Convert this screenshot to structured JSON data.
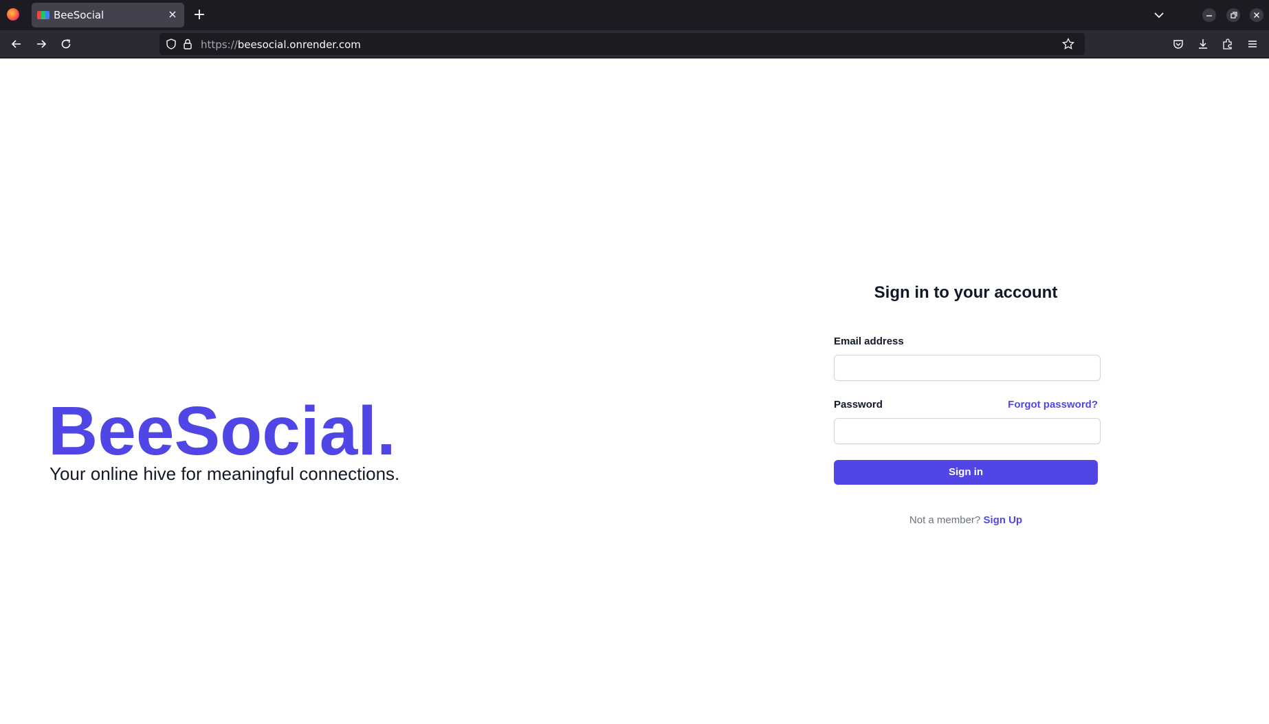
{
  "browser": {
    "tab_title": "BeeSocial",
    "tab_close": "×",
    "new_tab": "+",
    "url_protocol": "https://",
    "url_host": "beesocial.onrender.com"
  },
  "page": {
    "brand": "BeeSocial.",
    "tagline": "Your online hive for meaningful connections.",
    "signin_title": "Sign in to your account",
    "email_label": "Email address",
    "email_value": "",
    "password_label": "Password",
    "password_value": "",
    "forgot_link": "Forgot password?",
    "signin_button": "Sign in",
    "not_member_text": "Not a member?",
    "signup_link": "Sign Up"
  },
  "colors": {
    "accent": "#4f46e5",
    "heading": "#111827",
    "muted": "#6b7280"
  }
}
